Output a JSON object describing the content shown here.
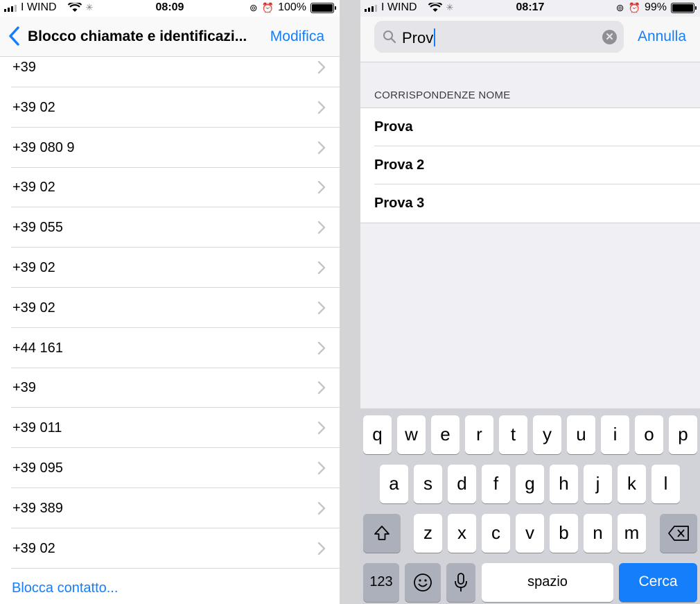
{
  "left": {
    "status": {
      "carrier": "I WIND",
      "time": "08:09",
      "battery": "100%",
      "battery_level": 1.0
    },
    "nav": {
      "back_icon": "chevron-left-icon",
      "title": "Blocco chiamate e identificazi...",
      "action": "Modifica"
    },
    "numbers": [
      "+39",
      "+39 02",
      "+39 080 9",
      "+39 02",
      "+39 055",
      "+39 02",
      "+39 02",
      "+44 161",
      "+39",
      "+39 011",
      "+39 095",
      "+39 389",
      "+39 02"
    ],
    "block_link": "Blocca contatto..."
  },
  "right": {
    "status": {
      "carrier": "I WIND",
      "time": "08:17",
      "battery": "99%",
      "battery_level": 0.99
    },
    "search": {
      "value": "Prov",
      "icon": "search-icon",
      "clear_icon": "clear-icon",
      "cancel": "Annulla"
    },
    "section_header": "CORRISPONDENZE NOME",
    "results": [
      "Prova",
      "Prova 2",
      "Prova 3"
    ],
    "keyboard": {
      "row1": [
        "q",
        "w",
        "e",
        "r",
        "t",
        "y",
        "u",
        "i",
        "o",
        "p"
      ],
      "row2": [
        "a",
        "s",
        "d",
        "f",
        "g",
        "h",
        "j",
        "k",
        "l"
      ],
      "row3": [
        "z",
        "x",
        "c",
        "v",
        "b",
        "n",
        "m"
      ],
      "numbers_key": "123",
      "space_key": "spazio",
      "return_key": "Cerca",
      "shift_icon": "shift-icon",
      "delete_icon": "delete-icon",
      "emoji_icon": "emoji-icon",
      "mic_icon": "microphone-icon"
    }
  }
}
